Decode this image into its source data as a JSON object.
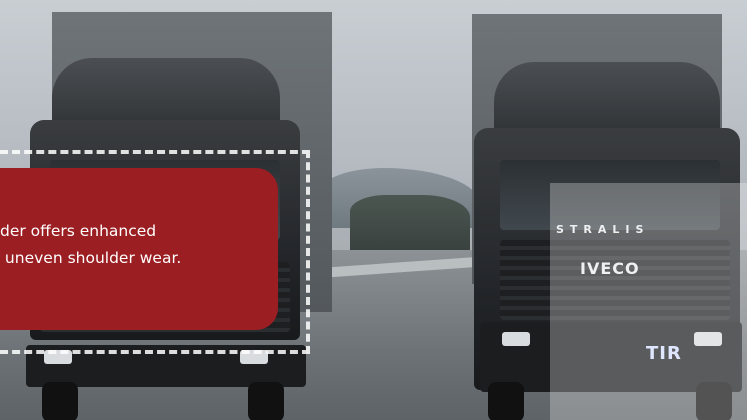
{
  "callout": {
    "line1": "der offers enhanced",
    "line2": " uneven shoulder wear."
  },
  "truck_right": {
    "brand": "IVECO",
    "model": "STRALIS",
    "plate": "TIR"
  },
  "colors": {
    "callout_bg": "#9b1e22",
    "overlay": "rgba(255,255,255,0.28)"
  },
  "icons": {
    "dash_outline": "dashed-outline-icon"
  }
}
